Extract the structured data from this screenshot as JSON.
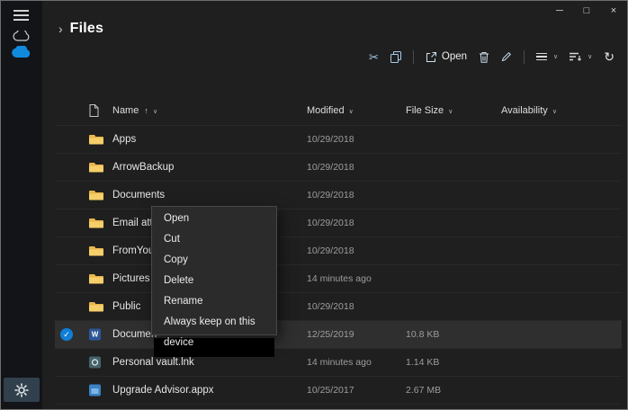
{
  "titlebar": {
    "minimize": "─",
    "maximize": "□",
    "close": "×"
  },
  "header": {
    "chevron": "›",
    "title": "Files"
  },
  "toolbar": {
    "cut_glyph": "✂",
    "open_label": "Open",
    "chevron_glyph": "∨",
    "refresh_glyph": "↻"
  },
  "table": {
    "columns": {
      "name": "Name",
      "modified": "Modified",
      "size": "File Size",
      "availability": "Availability"
    },
    "sort_ascending_glyph": "↑",
    "chevron_glyph": "∨",
    "check_glyph": "✓",
    "word_glyph": "W",
    "rows": [
      {
        "name": "Apps",
        "modified": "10/29/2018",
        "size": "",
        "availability": ""
      },
      {
        "name": "ArrowBackup",
        "modified": "10/29/2018",
        "size": "",
        "availability": ""
      },
      {
        "name": "Documents",
        "modified": "10/29/2018",
        "size": "",
        "availability": ""
      },
      {
        "name": "Email atta",
        "modified": "10/29/2018",
        "size": "",
        "availability": ""
      },
      {
        "name": "FromYou",
        "modified": "10/29/2018",
        "size": "",
        "availability": ""
      },
      {
        "name": "Pictures",
        "modified": "14 minutes ago",
        "size": "",
        "availability": ""
      },
      {
        "name": "Public",
        "modified": "10/29/2018",
        "size": "",
        "availability": ""
      },
      {
        "name": "Documen",
        "modified": "12/25/2019",
        "size": "10.8 KB",
        "availability": ""
      },
      {
        "name": "Personal vault.lnk",
        "modified": "14 minutes ago",
        "size": "1.14 KB",
        "availability": ""
      },
      {
        "name": "Upgrade Advisor.appx",
        "modified": "10/25/2017",
        "size": "2.67 MB",
        "availability": ""
      }
    ]
  },
  "context_menu": {
    "items": [
      "Open",
      "Cut",
      "Copy",
      "Delete",
      "Rename",
      "Always keep on this device"
    ]
  }
}
